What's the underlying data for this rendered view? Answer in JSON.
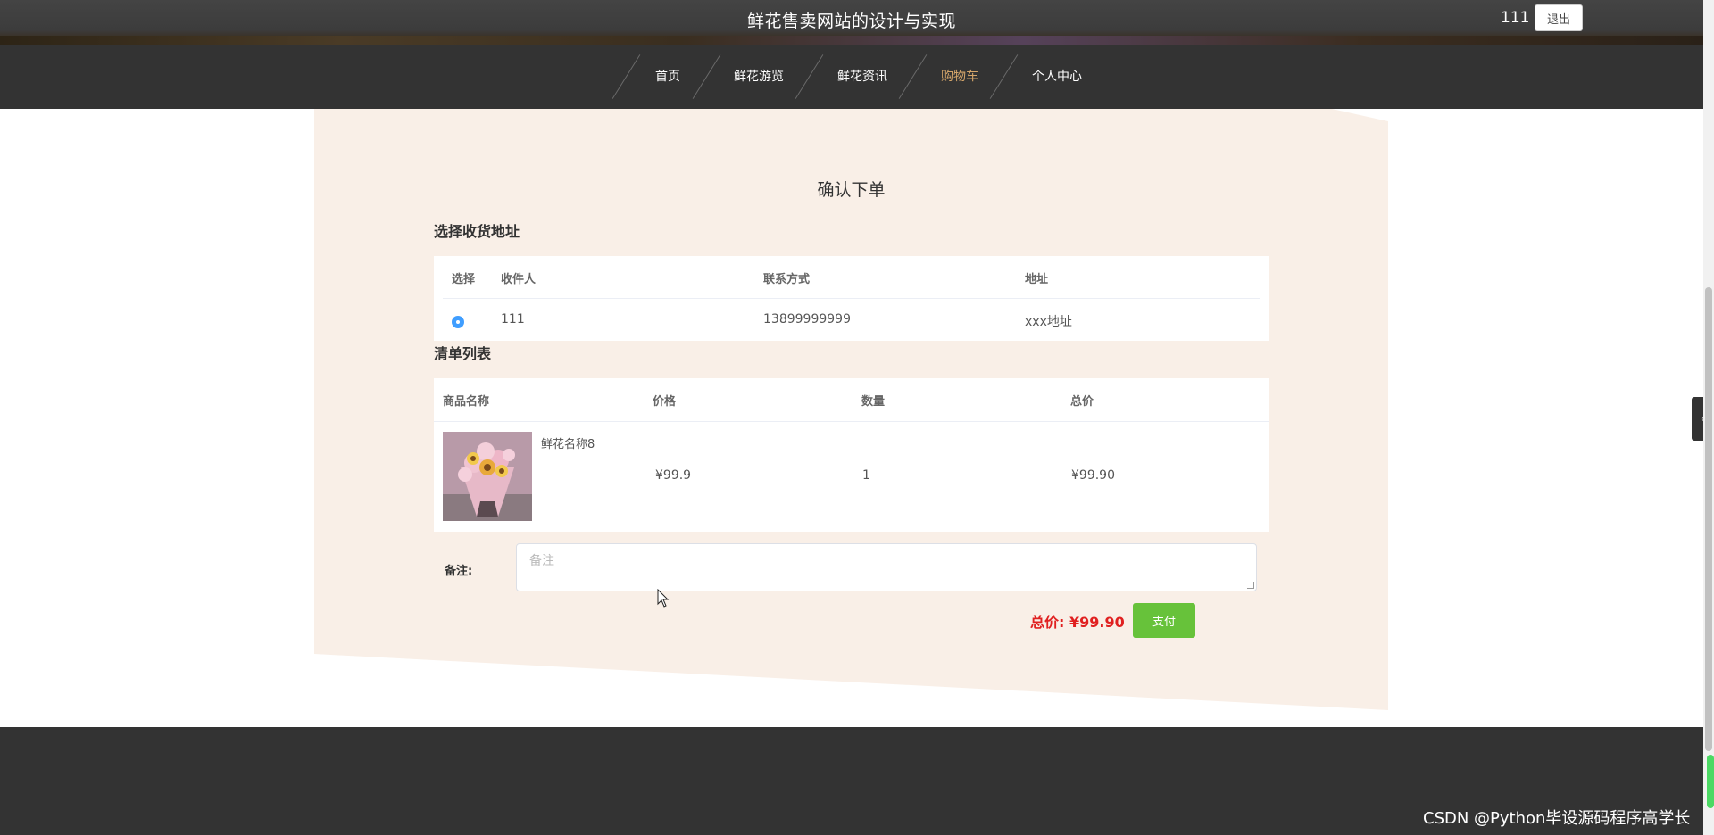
{
  "header": {
    "site_title": "鲜花售卖网站的设计与实现",
    "user_name": "111",
    "logout_label": "退出"
  },
  "nav": {
    "items": [
      {
        "label": "首页",
        "active": false
      },
      {
        "label": "鲜花游览",
        "active": false
      },
      {
        "label": "鲜花资讯",
        "active": false
      },
      {
        "label": "购物车",
        "active": true
      },
      {
        "label": "个人中心",
        "active": false
      }
    ],
    "active_color": "#d4a56a"
  },
  "order": {
    "title": "确认下单",
    "address_section": {
      "title": "选择收货地址",
      "columns": [
        "选择",
        "收件人",
        "联系方式",
        "地址"
      ],
      "rows": [
        {
          "selected": true,
          "recipient": "111",
          "phone": "13899999999",
          "address": "xxx地址"
        }
      ]
    },
    "items_section": {
      "title": "清单列表",
      "columns": [
        "商品名称",
        "价格",
        "数量",
        "总价"
      ],
      "rows": [
        {
          "name": "鲜花名称8",
          "price": "¥99.9",
          "quantity": "1",
          "total": "¥99.90"
        }
      ]
    },
    "remark": {
      "label": "备注:",
      "placeholder": "备注"
    },
    "total_label": "总价: ¥99.90",
    "pay_label": "支付"
  },
  "footer": {
    "watermark": "CSDN @Python毕设源码程序高学长"
  },
  "colors": {
    "header_bg": "#444444",
    "nav_bg": "#333333",
    "card_bg": "#f9efe7",
    "pay_button": "#67c23a",
    "total_text": "#e02020",
    "radio": "#409eff"
  }
}
